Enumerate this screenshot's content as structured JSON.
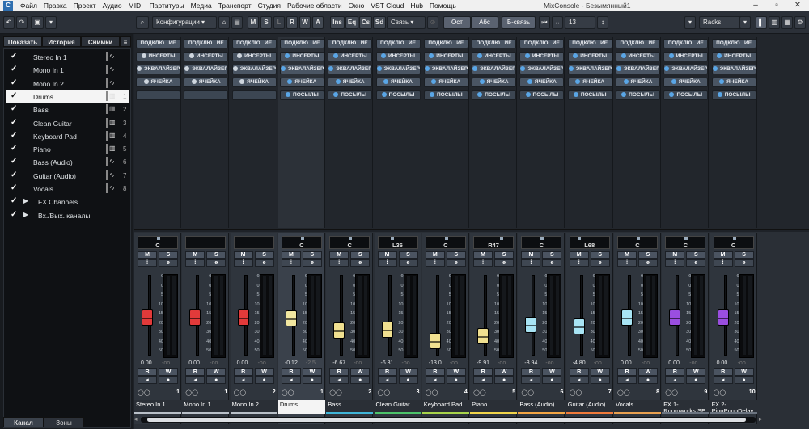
{
  "app_title": "MixConsole - Безымянный1",
  "menu": [
    "Файл",
    "Правка",
    "Проект",
    "Аудио",
    "MIDI",
    "Партитуры",
    "Медиа",
    "Транспорт",
    "Студия",
    "Рабочие области",
    "Окно",
    "VST Cloud",
    "Hub",
    "Помощь"
  ],
  "toolbar": {
    "configs_label": "Конфигурации",
    "m": "M",
    "s": "S",
    "l": "L",
    "r": "R",
    "w": "W",
    "a": "A",
    "ins": "Ins",
    "eq": "Eq",
    "cs": "Cs",
    "sd": "Sd",
    "link_label": "Связь",
    "ost": "Ост",
    "abs": "Абс",
    "b_link": "Б-связь",
    "count": "13",
    "racks": "Racks"
  },
  "left_panel": {
    "tabs": [
      "Показать",
      "История",
      "Снимки"
    ],
    "bottom_tabs": [
      "Канал",
      "Зоны"
    ],
    "items": [
      {
        "label": "Stereo In 1",
        "idx": "",
        "icon": "wave"
      },
      {
        "label": "Mono In 1",
        "idx": "",
        "icon": "wave"
      },
      {
        "label": "Mono In 2",
        "idx": "",
        "icon": "wave"
      },
      {
        "label": "Drums",
        "idx": "1",
        "icon": "keys"
      },
      {
        "label": "Bass",
        "idx": "2",
        "icon": "keys"
      },
      {
        "label": "Clean Guitar",
        "idx": "3",
        "icon": "keys"
      },
      {
        "label": "Keyboard Pad",
        "idx": "4",
        "icon": "keys"
      },
      {
        "label": "Piano",
        "idx": "5",
        "icon": "keys"
      },
      {
        "label": "Bass (Audio)",
        "idx": "6",
        "icon": "wave"
      },
      {
        "label": "Guitar (Audio)",
        "idx": "7",
        "icon": "wave"
      },
      {
        "label": "Vocals",
        "idx": "8",
        "icon": "wave"
      },
      {
        "label": "FX Channels",
        "idx": "",
        "icon": ""
      },
      {
        "label": "Вх./Вых. каналы",
        "idx": "",
        "icon": ""
      }
    ]
  },
  "rack_labels": {
    "routing": "ПОДКЛЮ...ИЕ",
    "inserts": "ИНСЕРТЫ",
    "eq": "ЭКВАЛАЙЗЕР",
    "strip": "ЯЧЕЙКА",
    "sends": "ПОСЫЛЫ"
  },
  "channels": [
    {
      "name": "Stereo In 1",
      "num": "1",
      "pan": "C",
      "vol": "0.00",
      "vol2": "-oo",
      "color": "#e23a3a",
      "line": "#b9c0c8",
      "fader": 0.52,
      "sends": false
    },
    {
      "name": "Mono In 1",
      "num": "1",
      "pan": "",
      "vol": "0.00",
      "vol2": "-oo",
      "color": "#e23a3a",
      "line": "#b9c0c8",
      "fader": 0.52,
      "sends": false
    },
    {
      "name": "Mono In 2",
      "num": "2",
      "pan": "",
      "vol": "0.00",
      "vol2": "-oo",
      "color": "#e23a3a",
      "line": "#b9c0c8",
      "fader": 0.52,
      "sends": false
    },
    {
      "name": "Drums",
      "num": "1",
      "pan": "C",
      "vol": "-0.12",
      "vol2": "-2.5",
      "color": "#f2e7a0",
      "line": "#f4f4f4",
      "fader": 0.53,
      "sends": true
    },
    {
      "name": "Bass",
      "num": "2",
      "pan": "C",
      "vol": "-6.67",
      "vol2": "-oo",
      "color": "#f0e090",
      "line": "#3fb5d8",
      "fader": 0.68,
      "sends": true
    },
    {
      "name": "Clean Guitar",
      "num": "3",
      "pan": "L36",
      "vol": "-6.31",
      "vol2": "-oo",
      "color": "#f0e090",
      "line": "#4cc36a",
      "fader": 0.67,
      "sends": true
    },
    {
      "name": "Keyboard Pad",
      "num": "4",
      "pan": "C",
      "vol": "-13.0",
      "vol2": "-oo",
      "color": "#f0e090",
      "line": "#a8d44b",
      "fader": 0.81,
      "sends": true
    },
    {
      "name": "Piano",
      "num": "5",
      "pan": "R47",
      "vol": "-9.91",
      "vol2": "-oo",
      "color": "#f0e090",
      "line": "#f0d44a",
      "fader": 0.75,
      "sends": true
    },
    {
      "name": "Bass (Audio)",
      "num": "6",
      "pan": "C",
      "vol": "-3.94",
      "vol2": "-oo",
      "color": "#a8e4f4",
      "line": "#f2a544",
      "fader": 0.61,
      "sends": true
    },
    {
      "name": "Guitar (Audio)",
      "num": "7",
      "pan": "L68",
      "vol": "-4.80",
      "vol2": "-oo",
      "color": "#a8e4f4",
      "line": "#f07a3a",
      "fader": 0.63,
      "sends": true
    },
    {
      "name": "Vocals",
      "num": "8",
      "pan": "C",
      "vol": "0.00",
      "vol2": "-oo",
      "color": "#a8e4f4",
      "line": "#e8a050",
      "fader": 0.52,
      "sends": true
    },
    {
      "name": "FX 1-Roomworks SE",
      "num": "9",
      "pan": "C",
      "vol": "0.00",
      "vol2": "-oo",
      "color": "#9a4ee0",
      "line": "#6b7480",
      "fader": 0.52,
      "sends": true
    },
    {
      "name": "FX 2-PingPongDelay",
      "num": "10",
      "pan": "C",
      "vol": "0.00",
      "vol2": "-oo",
      "color": "#9a4ee0",
      "line": "#6b7480",
      "fader": 0.52,
      "sends": true
    }
  ],
  "scale_marks": [
    "6",
    "0",
    "5",
    "10",
    "15",
    "20",
    "30",
    "40",
    "50"
  ]
}
